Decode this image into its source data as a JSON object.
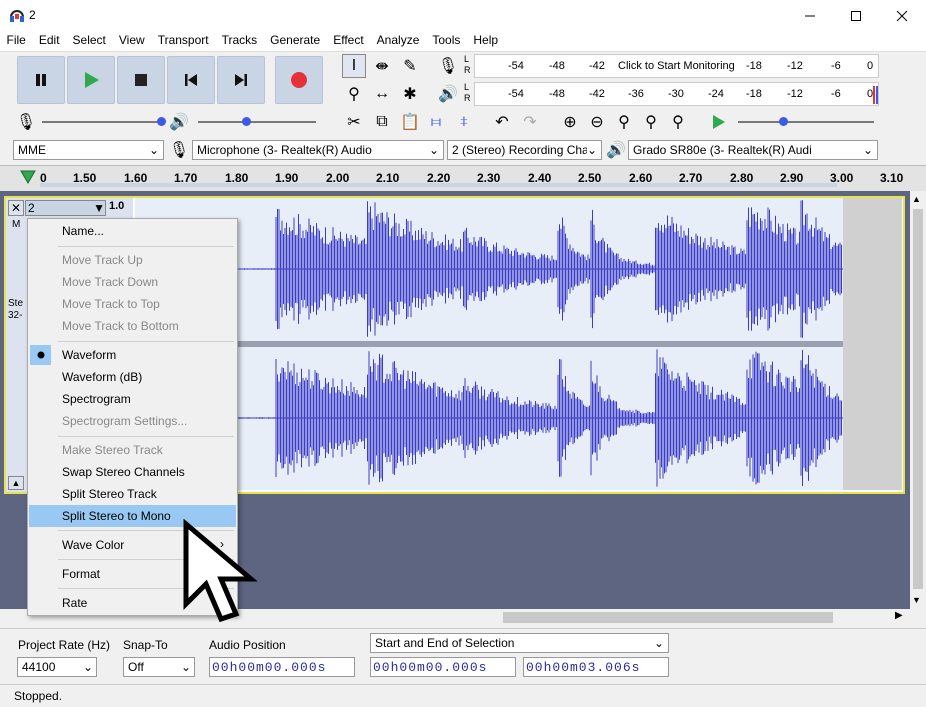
{
  "window": {
    "title": "2",
    "minimize": "—",
    "maximize": "☐",
    "close": "✕"
  },
  "menu_bar": [
    "File",
    "Edit",
    "Select",
    "View",
    "Transport",
    "Tracks",
    "Generate",
    "Effect",
    "Analyze",
    "Tools",
    "Help"
  ],
  "meters": {
    "record": {
      "channels": [
        "L",
        "R"
      ],
      "scale": [
        "-54",
        "-48",
        "-42"
      ],
      "prompt": "Click to Start Monitoring",
      "scale2": [
        "-18",
        "-12",
        "-6",
        "0"
      ]
    },
    "playback": {
      "channels": [
        "L",
        "R"
      ],
      "scale": [
        "-54",
        "-48",
        "-42",
        "-36",
        "-30",
        "-24",
        "-18",
        "-12",
        "-6",
        "0"
      ]
    }
  },
  "devices": {
    "host": "MME",
    "recording_device": "Microphone (3- Realtek(R) Audio",
    "channels": "2 (Stereo) Recording Chan",
    "playback_device": "Grado SR80e (3- Realtek(R) Audi"
  },
  "ruler": {
    "ticks": [
      "0",
      "1.50",
      "1.60",
      "1.70",
      "1.80",
      "1.90",
      "2.00",
      "2.10",
      "2.20",
      "2.30",
      "2.40",
      "2.50",
      "2.60",
      "2.70",
      "2.80",
      "2.90",
      "3.00",
      "3.10"
    ]
  },
  "track": {
    "name": "2",
    "scale_top": "1.0",
    "mute_initial": "M",
    "info1": "Ste",
    "info2": "32-"
  },
  "context_menu": {
    "items": [
      {
        "label": "Name...",
        "enabled": true
      },
      {
        "label": "Move Track Up",
        "enabled": false
      },
      {
        "label": "Move Track Down",
        "enabled": false
      },
      {
        "label": "Move Track to Top",
        "enabled": false
      },
      {
        "label": "Move Track to Bottom",
        "enabled": false
      },
      {
        "label": "Waveform",
        "enabled": true,
        "checked": true
      },
      {
        "label": "Waveform (dB)",
        "enabled": true
      },
      {
        "label": "Spectrogram",
        "enabled": true
      },
      {
        "label": "Spectrogram Settings...",
        "enabled": false
      },
      {
        "label": "Make Stereo Track",
        "enabled": false
      },
      {
        "label": "Swap Stereo Channels",
        "enabled": true
      },
      {
        "label": "Split Stereo Track",
        "enabled": true
      },
      {
        "label": "Split Stereo to Mono",
        "enabled": true,
        "highlighted": true
      },
      {
        "label": "Wave Color",
        "enabled": true,
        "submenu": true
      },
      {
        "label": "Format",
        "enabled": true
      },
      {
        "label": "Rate",
        "enabled": true
      }
    ]
  },
  "selection_toolbar": {
    "project_rate_label": "Project Rate (Hz)",
    "project_rate": "44100",
    "snap_to_label": "Snap-To",
    "snap_to": "Off",
    "audio_position_label": "Audio Position",
    "audio_position": "00h00m00.000s",
    "selection_mode": "Start and End of Selection",
    "selection_start": "00h00m00.000s",
    "selection_end": "00h00m03.006s"
  },
  "status": "Stopped.",
  "colors": {
    "waveform": "#3c3cc8",
    "track_bg": "#e8eef8",
    "highlight": "#99c9f3",
    "record": "#e8303a",
    "play": "#2fa84f"
  }
}
